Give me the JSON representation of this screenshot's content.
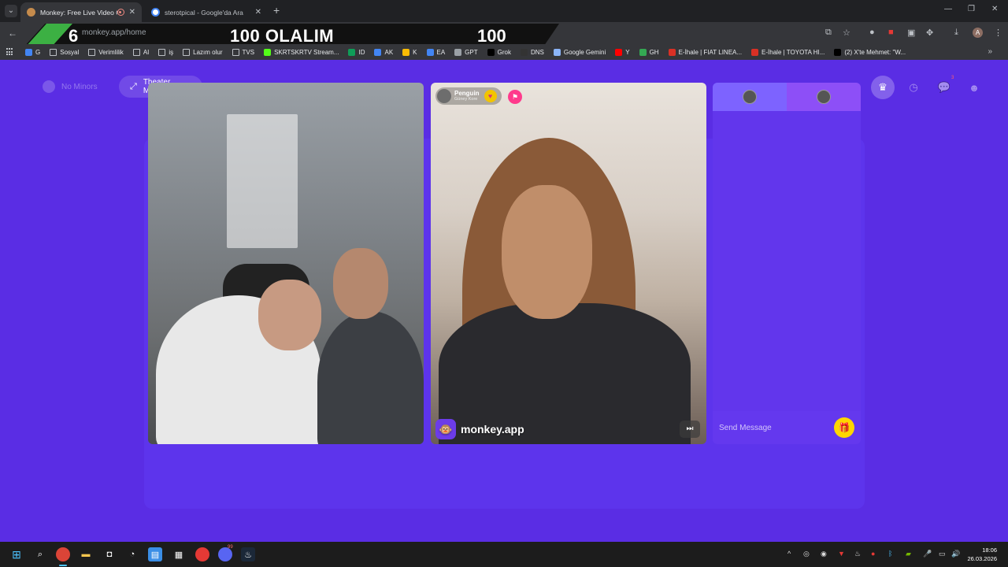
{
  "browser": {
    "tabs": [
      {
        "title": "Monkey: Free Live Video Ch",
        "active": true
      },
      {
        "title": "sterotpical - Google'da Ara",
        "active": false
      }
    ],
    "new_tab": "+",
    "url": "monkey.app/home",
    "window_controls": [
      "—",
      "❐",
      "✕"
    ]
  },
  "stream_overlay": {
    "left_count": "6",
    "banner_text": "100 OLALIM",
    "right_count": "100"
  },
  "bookmarks": [
    {
      "label": "G",
      "icon": "google-icon"
    },
    {
      "label": "Sosyal",
      "icon": "folder-icon"
    },
    {
      "label": "Verimlilik",
      "icon": "folder-icon"
    },
    {
      "label": "AI",
      "icon": "folder-icon"
    },
    {
      "label": "iş",
      "icon": "folder-icon"
    },
    {
      "label": "Lazım olur",
      "icon": "folder-icon"
    },
    {
      "label": "TVS",
      "icon": "folder-icon"
    },
    {
      "label": "SKRTSKRTV Stream...",
      "icon": "kick-icon"
    },
    {
      "label": "ID",
      "icon": "sheet-icon"
    },
    {
      "label": "AK",
      "icon": "doc-icon"
    },
    {
      "label": "K",
      "icon": "keep-icon"
    },
    {
      "label": "EA",
      "icon": "doc-icon"
    },
    {
      "label": "GPT",
      "icon": "chatgpt-icon"
    },
    {
      "label": "Grok",
      "icon": "x-icon"
    },
    {
      "label": "DNS",
      "icon": "dns-icon"
    },
    {
      "label": "Google Gemini",
      "icon": "gemini-icon"
    },
    {
      "label": "Y",
      "icon": "youtube-icon"
    },
    {
      "label": "GH",
      "icon": "maps-icon"
    },
    {
      "label": "E-İhale | FIAT LINEA...",
      "icon": "tender-icon"
    },
    {
      "label": "E-İhale | TOYOTA HI...",
      "icon": "tender-icon"
    },
    {
      "label": "(2) X'te Mehmet: \"W...",
      "icon": "x-icon"
    }
  ],
  "page": {
    "no_minors_label": "No Minors",
    "theater_mode_label": "Theater Mode",
    "notification_count": "3",
    "peer": {
      "name": "Penguin",
      "country": "Güney Kore"
    },
    "watermark": "monkey.app",
    "chat": {
      "placeholder": "Send Message"
    },
    "colors": {
      "background": "#5a2de4",
      "gift": "#ffd600"
    }
  },
  "taskbar": {
    "time": "18:06",
    "date": "26.03.2026",
    "discord_badge": "99"
  }
}
